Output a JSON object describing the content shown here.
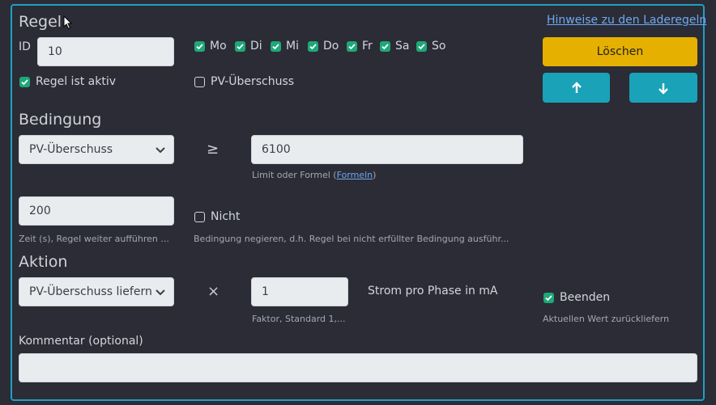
{
  "rule": {
    "heading": "Regel",
    "help_link": "Hinweise zu den Laderegeln",
    "id_label": "ID",
    "id_value": "10",
    "days": [
      {
        "label": "Mo",
        "checked": true
      },
      {
        "label": "Di",
        "checked": true
      },
      {
        "label": "Mi",
        "checked": true
      },
      {
        "label": "Do",
        "checked": true
      },
      {
        "label": "Fr",
        "checked": true
      },
      {
        "label": "Sa",
        "checked": true
      },
      {
        "label": "So",
        "checked": true
      }
    ],
    "active_label": "Regel ist aktiv",
    "active_checked": true,
    "pv_label": "PV-Überschuss",
    "pv_checked": false,
    "delete_label": "Löschen",
    "up_icon": "arrow-up-icon",
    "down_icon": "arrow-down-icon"
  },
  "condition": {
    "heading": "Bedingung",
    "select_value": "PV-Überschuss",
    "operator": "≥",
    "limit_value": "6100",
    "limit_hint": "Limit oder Formel (",
    "limit_hint_link": "Formeln",
    "limit_hint_end": ")",
    "time_value": "200",
    "time_hint": "Zeit (s), Regel weiter aufführen ...",
    "negate_label": "Nicht",
    "negate_checked": false,
    "negate_hint": "Bedingung negieren, d.h. Regel bei nicht erfüllter Bedingung ausführ..."
  },
  "action": {
    "heading": "Aktion",
    "select_value": "PV-Überschuss liefern",
    "operator": "×",
    "factor_value": "1",
    "factor_hint": "Faktor, Standard 1,...",
    "unit_label": "Strom pro Phase in mA",
    "finish_label": "Beenden",
    "finish_checked": true,
    "finish_hint": "Aktuellen Wert zurückliefern"
  },
  "comment": {
    "label": "Kommentar (optional)",
    "value": ""
  },
  "colors": {
    "accent": "#1f9fc3",
    "delete": "#e6b000",
    "move": "#19a2b8",
    "checkbox": "#1ea879"
  }
}
